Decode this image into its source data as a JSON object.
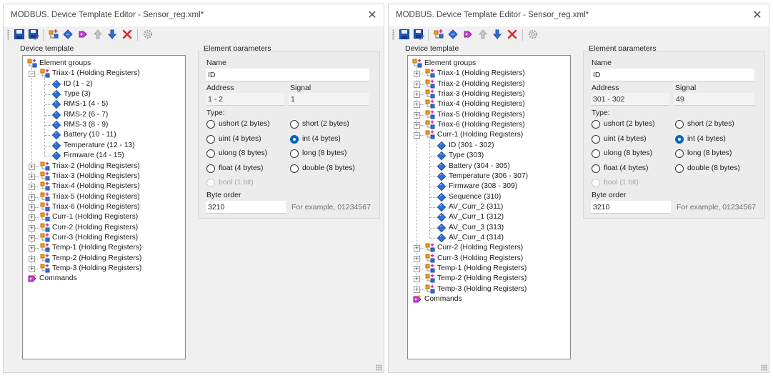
{
  "colors": {
    "window_bg": "#f0f0f0",
    "accent": "#0067c0",
    "element_icon": "#2f6fd6",
    "delete_icon": "#e02424"
  },
  "windows": [
    {
      "title": "MODBUS. Device Template Editor - Sensor_reg.xml*",
      "close_label": "✕",
      "device_template_label": "Device template",
      "element_parameters_label": "Element parameters",
      "toolbar_icons": [
        "save-icon",
        "save-as-icon",
        "add-group-icon",
        "add-element-icon",
        "add-command-icon",
        "move-up-icon",
        "move-down-icon",
        "delete-icon",
        "settings-icon"
      ],
      "tree": [
        {
          "label": "Element groups",
          "level": 0,
          "icon": "element-groups-icon"
        },
        {
          "label": "Triax-1 (Holding Registers)",
          "level": 1,
          "icon": "group-icon",
          "expanded": true
        },
        {
          "label": "ID (1 - 2)",
          "level": 2,
          "icon": "element-icon"
        },
        {
          "label": "Type (3)",
          "level": 2,
          "icon": "element-icon"
        },
        {
          "label": "RMS-1 (4 - 5)",
          "level": 2,
          "icon": "element-icon"
        },
        {
          "label": "RMS-2 (6 - 7)",
          "level": 2,
          "icon": "element-icon"
        },
        {
          "label": "RMS-3 (8 - 9)",
          "level": 2,
          "icon": "element-icon"
        },
        {
          "label": "Battery (10 - 11)",
          "level": 2,
          "icon": "element-icon"
        },
        {
          "label": "Temperature (12 - 13)",
          "level": 2,
          "icon": "element-icon"
        },
        {
          "label": "Firmware (14 - 15)",
          "level": 2,
          "icon": "element-icon"
        },
        {
          "label": "Triax-2 (Holding Registers)",
          "level": 1,
          "icon": "group-icon",
          "expanded": false
        },
        {
          "label": "Triax-3 (Holding Registers)",
          "level": 1,
          "icon": "group-icon",
          "expanded": false
        },
        {
          "label": "Triax-4 (Holding Registers)",
          "level": 1,
          "icon": "group-icon",
          "expanded": false
        },
        {
          "label": "Triax-5 (Holding Registers)",
          "level": 1,
          "icon": "group-icon",
          "expanded": false
        },
        {
          "label": "Triax-6 (Holding Registers)",
          "level": 1,
          "icon": "group-icon",
          "expanded": false
        },
        {
          "label": "Curr-1 (Holding Registers)",
          "level": 1,
          "icon": "group-icon",
          "expanded": false
        },
        {
          "label": "Curr-2 (Holding Registers)",
          "level": 1,
          "icon": "group-icon",
          "expanded": false
        },
        {
          "label": "Curr-3 (Holding Registers)",
          "level": 1,
          "icon": "group-icon",
          "expanded": false
        },
        {
          "label": "Temp-1 (Holding Registers)",
          "level": 1,
          "icon": "group-icon",
          "expanded": false
        },
        {
          "label": "Temp-2 (Holding Registers)",
          "level": 1,
          "icon": "group-icon",
          "expanded": false
        },
        {
          "label": "Temp-3 (Holding Registers)",
          "level": 1,
          "icon": "group-icon",
          "expanded": false
        },
        {
          "label": "Commands",
          "level": 0,
          "icon": "commands-icon"
        }
      ],
      "params": {
        "name_label": "Name",
        "name_value": "ID",
        "address_label": "Address",
        "address_value": "1 - 2",
        "signal_label": "Signal",
        "signal_value": "1",
        "type_label": "Type:",
        "types": [
          {
            "label": "ushort (2 bytes)",
            "checked": false,
            "disabled": false
          },
          {
            "label": "short (2 bytes)",
            "checked": false,
            "disabled": false
          },
          {
            "label": "uint (4 bytes)",
            "checked": false,
            "disabled": false
          },
          {
            "label": "int (4 bytes)",
            "checked": true,
            "disabled": false
          },
          {
            "label": "ulong (8 bytes)",
            "checked": false,
            "disabled": false
          },
          {
            "label": "long (8 bytes)",
            "checked": false,
            "disabled": false
          },
          {
            "label": "float (4 bytes)",
            "checked": false,
            "disabled": false
          },
          {
            "label": "double (8 bytes)",
            "checked": false,
            "disabled": false
          },
          {
            "label": "bool (1 bit)",
            "checked": false,
            "disabled": true
          }
        ],
        "byte_order_label": "Byte order",
        "byte_order_value": "3210",
        "example_text": "For example, 01234567"
      }
    },
    {
      "title": "MODBUS. Device Template Editor - Sensor_reg.xml*",
      "close_label": "✕",
      "device_template_label": "Device template",
      "element_parameters_label": "Element parameters",
      "toolbar_icons": [
        "save-icon",
        "save-as-icon",
        "add-group-icon",
        "add-element-icon",
        "add-command-icon",
        "move-up-icon",
        "move-down-icon",
        "delete-icon",
        "settings-icon"
      ],
      "tree": [
        {
          "label": "Element groups",
          "level": 0,
          "icon": "element-groups-icon"
        },
        {
          "label": "Triax-1 (Holding Registers)",
          "level": 1,
          "icon": "group-icon",
          "expanded": false
        },
        {
          "label": "Triax-2 (Holding Registers)",
          "level": 1,
          "icon": "group-icon",
          "expanded": false
        },
        {
          "label": "Triax-3 (Holding Registers)",
          "level": 1,
          "icon": "group-icon",
          "expanded": false
        },
        {
          "label": "Triax-4 (Holding Registers)",
          "level": 1,
          "icon": "group-icon",
          "expanded": false
        },
        {
          "label": "Triax-5 (Holding Registers)",
          "level": 1,
          "icon": "group-icon",
          "expanded": false
        },
        {
          "label": "Triax-6 (Holding Registers)",
          "level": 1,
          "icon": "group-icon",
          "expanded": false
        },
        {
          "label": "Curr-1 (Holding Registers)",
          "level": 1,
          "icon": "group-icon",
          "expanded": true
        },
        {
          "label": "ID (301 - 302)",
          "level": 2,
          "icon": "element-icon"
        },
        {
          "label": "Type (303)",
          "level": 2,
          "icon": "element-icon"
        },
        {
          "label": "Battery (304 - 305)",
          "level": 2,
          "icon": "element-icon"
        },
        {
          "label": "Temperature (306 - 307)",
          "level": 2,
          "icon": "element-icon"
        },
        {
          "label": "Firmware (308 - 309)",
          "level": 2,
          "icon": "element-icon"
        },
        {
          "label": "Sequence (310)",
          "level": 2,
          "icon": "element-icon"
        },
        {
          "label": "AV_Curr_2 (311)",
          "level": 2,
          "icon": "element-icon"
        },
        {
          "label": "AV_Curr_1 (312)",
          "level": 2,
          "icon": "element-icon"
        },
        {
          "label": "AV_Curr_3 (313)",
          "level": 2,
          "icon": "element-icon"
        },
        {
          "label": "AV_Curr_4 (314)",
          "level": 2,
          "icon": "element-icon"
        },
        {
          "label": "Curr-2 (Holding Registers)",
          "level": 1,
          "icon": "group-icon",
          "expanded": false
        },
        {
          "label": "Curr-3 (Holding Registers)",
          "level": 1,
          "icon": "group-icon",
          "expanded": false
        },
        {
          "label": "Temp-1 (Holding Registers)",
          "level": 1,
          "icon": "group-icon",
          "expanded": false
        },
        {
          "label": "Temp-2 (Holding Registers)",
          "level": 1,
          "icon": "group-icon",
          "expanded": false
        },
        {
          "label": "Temp-3 (Holding Registers)",
          "level": 1,
          "icon": "group-icon",
          "expanded": false
        },
        {
          "label": "Commands",
          "level": 0,
          "icon": "commands-icon"
        }
      ],
      "params": {
        "name_label": "Name",
        "name_value": "ID",
        "address_label": "Address",
        "address_value": "301 - 302",
        "signal_label": "Signal",
        "signal_value": "49",
        "type_label": "Type:",
        "types": [
          {
            "label": "ushort (2 bytes)",
            "checked": false,
            "disabled": false
          },
          {
            "label": "short (2 bytes)",
            "checked": false,
            "disabled": false
          },
          {
            "label": "uint (4 bytes)",
            "checked": false,
            "disabled": false
          },
          {
            "label": "int (4 bytes)",
            "checked": true,
            "disabled": false
          },
          {
            "label": "ulong (8 bytes)",
            "checked": false,
            "disabled": false
          },
          {
            "label": "long (8 bytes)",
            "checked": false,
            "disabled": false
          },
          {
            "label": "float (4 bytes)",
            "checked": false,
            "disabled": false
          },
          {
            "label": "double (8 bytes)",
            "checked": false,
            "disabled": false
          },
          {
            "label": "bool (1 bit)",
            "checked": false,
            "disabled": true
          }
        ],
        "byte_order_label": "Byte order",
        "byte_order_value": "3210",
        "example_text": "For example, 01234567"
      }
    }
  ]
}
